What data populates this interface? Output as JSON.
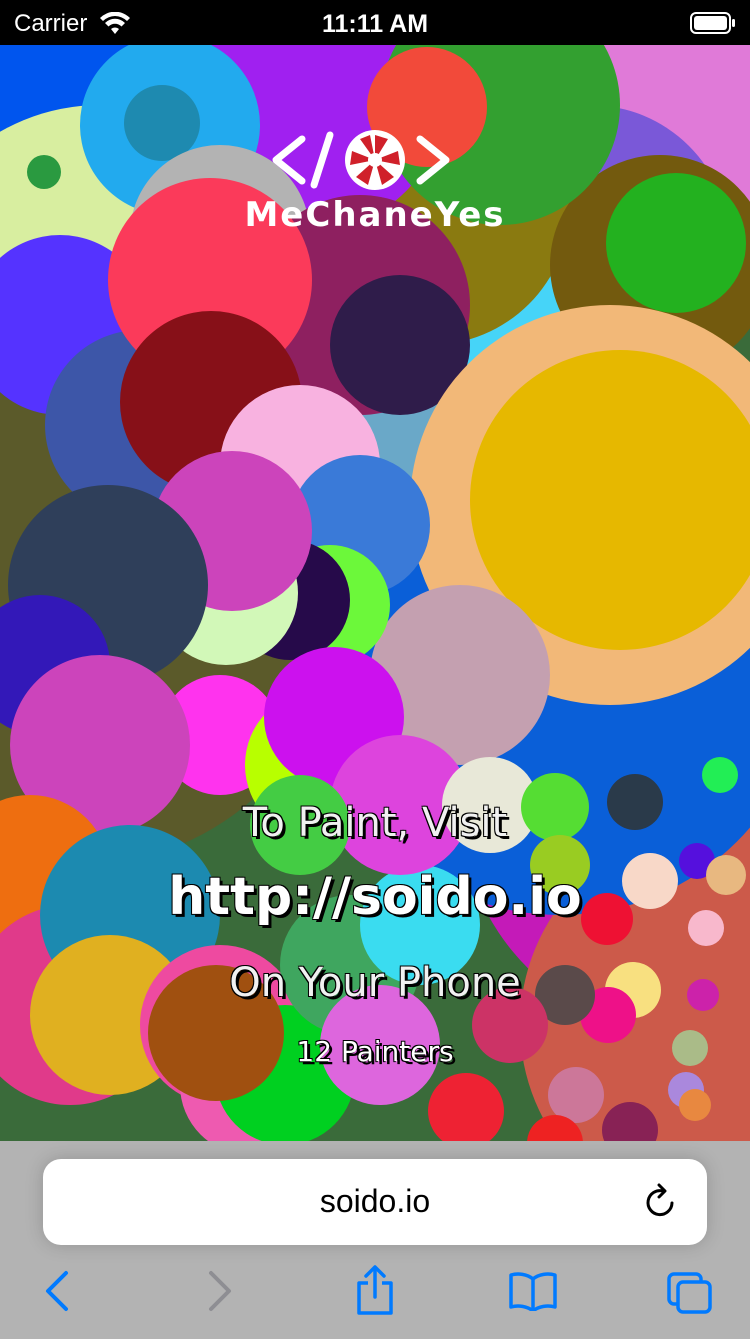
{
  "status": {
    "carrier": "Carrier",
    "time": "11:11 AM"
  },
  "logo": {
    "brackets_left": "</",
    "brackets_right": ">",
    "wordmark": "MeChaneYes"
  },
  "message": {
    "line1": "To Paint, Visit",
    "url": "http://soido.io",
    "line3": "On Your Phone",
    "painters": "12 Painters"
  },
  "browser": {
    "address": "soido.io"
  },
  "icons": {
    "wifi": "wifi-icon",
    "battery": "battery-icon",
    "reload": "reload-icon",
    "back": "chevron-left-icon",
    "forward": "chevron-right-icon",
    "share": "share-icon",
    "bookmarks": "book-icon",
    "tabs": "tabs-icon"
  },
  "colors": {
    "accent": "#007aff",
    "disabled": "#8e8e93",
    "toolbar_bg": "#b3b3b3"
  }
}
